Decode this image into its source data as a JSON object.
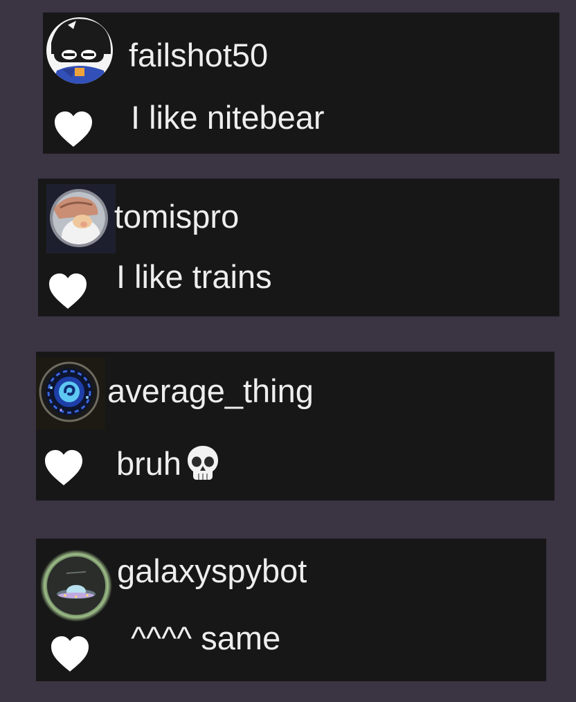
{
  "comments": [
    {
      "username": "failshot50",
      "message": "I like nitebear",
      "avatar": "goggles-cartoon-avatar",
      "liked": false
    },
    {
      "username": "tomispro",
      "message": "I like trains",
      "avatar": "gnome-hat-avatar",
      "liked": false
    },
    {
      "username": "average_thing",
      "message": "bruh",
      "message_emoji": "skull-icon",
      "avatar": "blue-orb-avatar",
      "liked": false
    },
    {
      "username": "galaxyspybot",
      "message": "^^^^ same",
      "avatar": "ufo-avatar",
      "liked": false
    }
  ],
  "colors": {
    "page_background": "#3b3443",
    "comment_background": "#171717",
    "text": "#eeeeee",
    "heart": "#ffffff"
  },
  "icons": {
    "like": "white-heart-icon"
  }
}
